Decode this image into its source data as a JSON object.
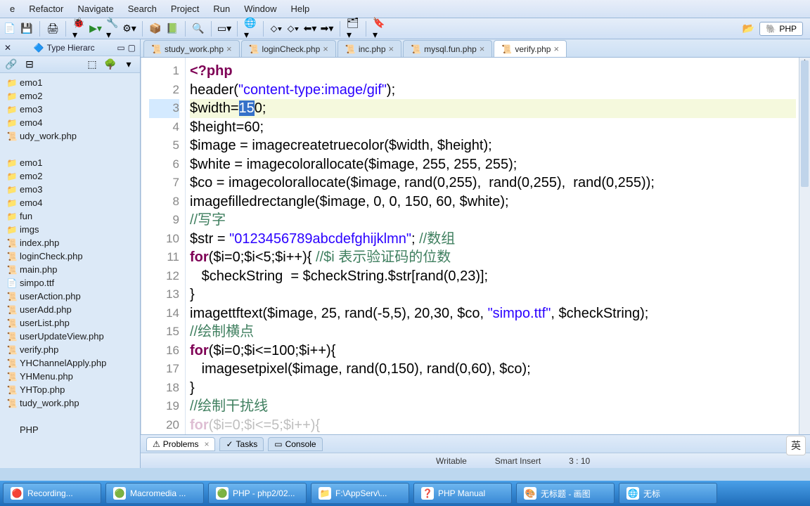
{
  "menu": {
    "items": [
      "e",
      "Refactor",
      "Navigate",
      "Search",
      "Project",
      "Run",
      "Window",
      "Help"
    ]
  },
  "perspective": {
    "label": "PHP"
  },
  "sidebar": {
    "view_title": "Type Hierarc",
    "items": [
      {
        "icon": "📁",
        "label": "emo1"
      },
      {
        "icon": "📁",
        "label": "emo2"
      },
      {
        "icon": "📁",
        "label": "emo3"
      },
      {
        "icon": "📁",
        "label": "emo4"
      },
      {
        "icon": "📜",
        "label": "udy_work.php"
      },
      {
        "icon": "",
        "label": ""
      },
      {
        "icon": "📁",
        "label": "emo1"
      },
      {
        "icon": "📁",
        "label": "emo2"
      },
      {
        "icon": "📁",
        "label": "emo3"
      },
      {
        "icon": "📁",
        "label": "emo4"
      },
      {
        "icon": "📁",
        "label": "fun"
      },
      {
        "icon": "📁",
        "label": "imgs"
      },
      {
        "icon": "📜",
        "label": "index.php"
      },
      {
        "icon": "📜",
        "label": "loginCheck.php"
      },
      {
        "icon": "📜",
        "label": "main.php"
      },
      {
        "icon": "📄",
        "label": "simpo.ttf"
      },
      {
        "icon": "📜",
        "label": "userAction.php"
      },
      {
        "icon": "📜",
        "label": "userAdd.php"
      },
      {
        "icon": "📜",
        "label": "userList.php"
      },
      {
        "icon": "📜",
        "label": "userUpdateView.php"
      },
      {
        "icon": "📜",
        "label": "verify.php"
      },
      {
        "icon": "📜",
        "label": "YHChannelApply.php"
      },
      {
        "icon": "📜",
        "label": "YHMenu.php"
      },
      {
        "icon": "📜",
        "label": "YHTop.php"
      },
      {
        "icon": "📜",
        "label": "tudy_work.php"
      },
      {
        "icon": "",
        "label": ""
      },
      {
        "icon": "",
        "label": "PHP"
      }
    ]
  },
  "tabs": [
    {
      "label": "study_work.php",
      "active": false
    },
    {
      "label": "loginCheck.php",
      "active": false
    },
    {
      "label": "inc.php",
      "active": false
    },
    {
      "label": "mysql.fun.php",
      "active": false
    },
    {
      "label": "verify.php",
      "active": true
    }
  ],
  "code": {
    "current_line": 3,
    "lines": [
      {
        "n": 1,
        "html": "<span class='php'>&lt;?php</span>"
      },
      {
        "n": 2,
        "html": "header(<span class='str'>\"content-type:image/gif\"</span>);"
      },
      {
        "n": 3,
        "html": "$width=<span class='sel'>15</span>0;"
      },
      {
        "n": 4,
        "html": "$height=60;"
      },
      {
        "n": 5,
        "html": "$image = imagecreatetruecolor($width, $height);"
      },
      {
        "n": 6,
        "html": "$white = imagecolorallocate($image, 255, 255, 255);"
      },
      {
        "n": 7,
        "html": "$co = imagecolorallocate($image, rand(0,255),  rand(0,255),  rand(0,255));"
      },
      {
        "n": 8,
        "html": "imagefilledrectangle($image, 0, 0, 150, 60, $white);"
      },
      {
        "n": 9,
        "html": "<span class='com'>//写字</span>"
      },
      {
        "n": 10,
        "html": "$str = <span class='str'>\"0123456789abcdefghijklmn\"</span>; <span class='com'>//数组</span>"
      },
      {
        "n": 11,
        "html": "<span class='kw'>for</span>($i=0;$i&lt;5;$i++){ <span class='com'>//$i 表示验证码的位数</span>"
      },
      {
        "n": 12,
        "html": "   $checkString  = $checkString.$str[rand(0,23)];"
      },
      {
        "n": 13,
        "html": "}"
      },
      {
        "n": 14,
        "html": "imagettftext($image, 25, rand(-5,5), 20,30, $co, <span class='str'>\"simpo.ttf\"</span>, $checkString);"
      },
      {
        "n": 15,
        "html": "<span class='com'>//绘制横点</span>"
      },
      {
        "n": 16,
        "html": "<span class='kw'>for</span>($i=0;$i&lt;=100;$i++){"
      },
      {
        "n": 17,
        "html": "   imagesetpixel($image, rand(0,150), rand(0,60), $co);"
      },
      {
        "n": 18,
        "html": "}"
      },
      {
        "n": 19,
        "html": "<span class='com'>//绘制干扰线</span>"
      },
      {
        "n": 20,
        "html": "<span class='kw' style='opacity:.25'>for</span><span style='opacity:.25'>($i=0;$i&lt;=5;$i++){</span>"
      }
    ]
  },
  "bottom_views": [
    {
      "label": "Problems",
      "active": true,
      "icon": "⚠"
    },
    {
      "label": "Tasks",
      "active": false,
      "icon": "✓"
    },
    {
      "label": "Console",
      "active": false,
      "icon": "▭"
    }
  ],
  "status": {
    "state": "Writable",
    "mode": "Smart Insert",
    "pos": "3 : 10"
  },
  "taskbar": [
    {
      "icon": "🔴",
      "label": "Recording..."
    },
    {
      "icon": "🟢",
      "label": "Macromedia ..."
    },
    {
      "icon": "🟢",
      "label": "PHP - php2/02..."
    },
    {
      "icon": "📁",
      "label": "F:\\AppServ\\..."
    },
    {
      "icon": "❓",
      "label": "PHP Manual"
    },
    {
      "icon": "🎨",
      "label": "无标题 - 画图"
    },
    {
      "icon": "🌐",
      "label": "无标"
    }
  ],
  "lang_indicator": "英"
}
